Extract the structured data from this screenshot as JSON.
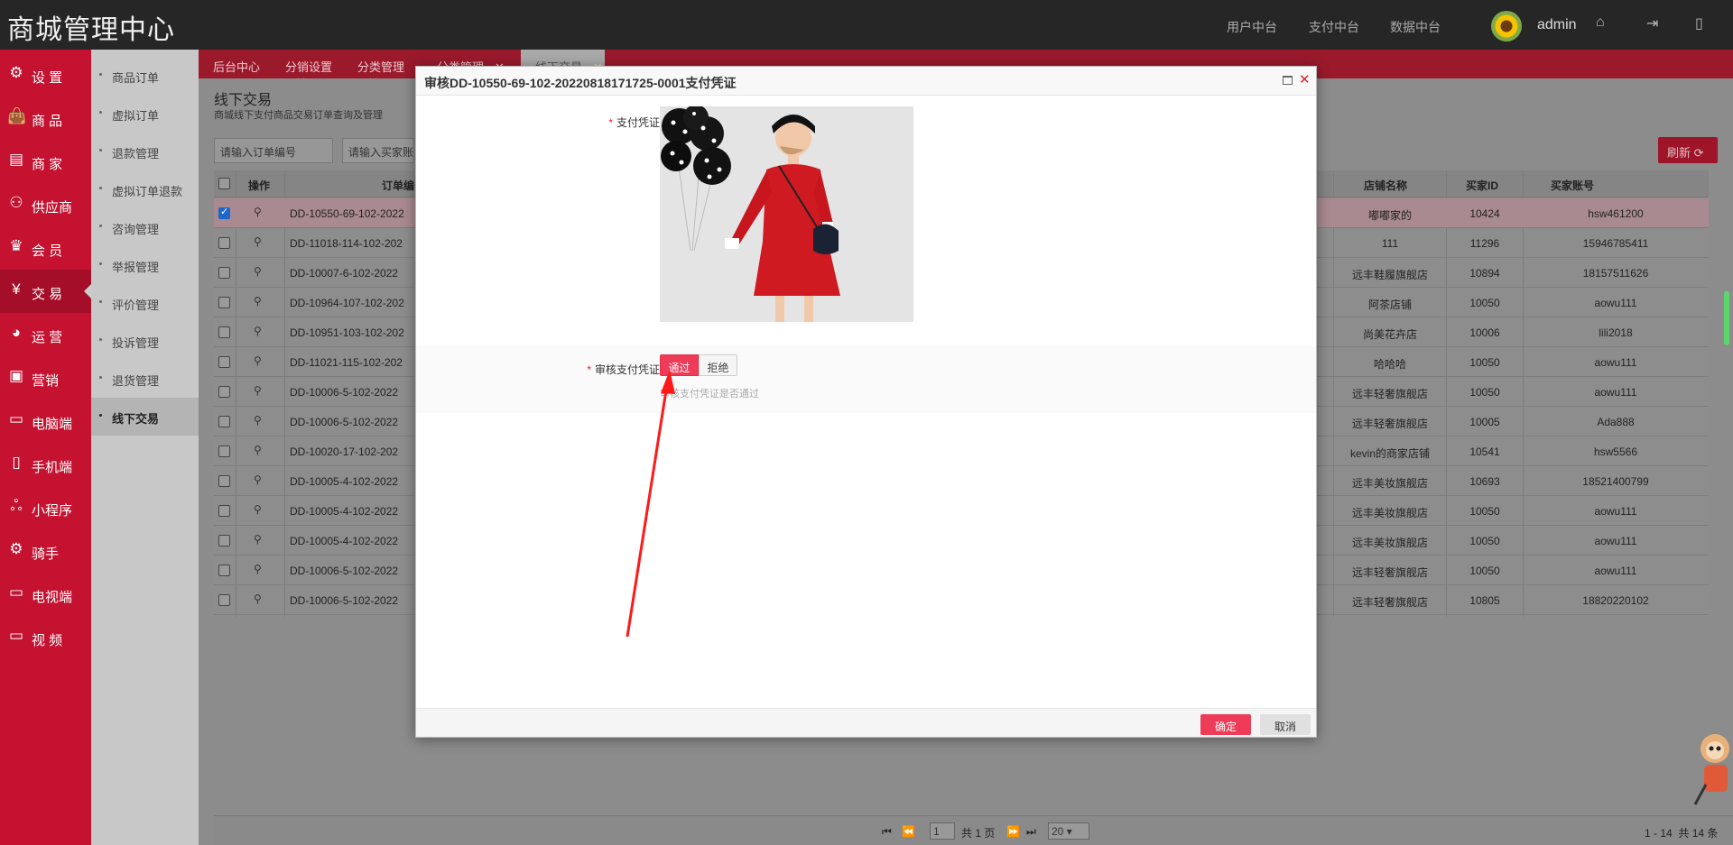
{
  "header": {
    "logo": "商城管理中心",
    "nav": [
      "用户中台",
      "支付中台",
      "数据中台"
    ],
    "username": "admin"
  },
  "menu": [
    {
      "label": "设 置",
      "icon": "gear-icon",
      "glyph": "⚙"
    },
    {
      "label": "商 品",
      "icon": "bag-icon",
      "glyph": "👜"
    },
    {
      "label": "商 家",
      "icon": "store-icon",
      "glyph": "▤"
    },
    {
      "label": "供应商",
      "icon": "supplier-icon",
      "glyph": "⚇"
    },
    {
      "label": "会 员",
      "icon": "crown-icon",
      "glyph": "♛"
    },
    {
      "label": "交 易",
      "icon": "yen-icon",
      "glyph": "¥"
    },
    {
      "label": "运 营",
      "icon": "pie-icon",
      "glyph": "◕"
    },
    {
      "label": "营销",
      "icon": "marketing-icon",
      "glyph": "▣"
    },
    {
      "label": "电脑端",
      "icon": "desktop-icon",
      "glyph": "▭"
    },
    {
      "label": "手机端",
      "icon": "mobile-icon",
      "glyph": "▯"
    },
    {
      "label": "小程序",
      "icon": "miniprogram-icon",
      "glyph": "ஃ"
    },
    {
      "label": "骑手",
      "icon": "rider-icon",
      "glyph": "⚙"
    },
    {
      "label": "电视端",
      "icon": "tv-icon",
      "glyph": "▭"
    },
    {
      "label": "视 频",
      "icon": "video-icon",
      "glyph": "▭"
    }
  ],
  "submenu": [
    "商品订单",
    "虚拟订单",
    "退款管理",
    "虚拟订单退款",
    "咨询管理",
    "举报管理",
    "评价管理",
    "投诉管理",
    "退货管理",
    "线下交易"
  ],
  "tabs": [
    {
      "label": "后台中心",
      "close": ""
    },
    {
      "label": "分销设置",
      "close": "✕"
    },
    {
      "label": "分类管理",
      "close": "✕"
    },
    {
      "label": "分类管理",
      "close": "✕"
    },
    {
      "label": "线下交易",
      "close": "✕"
    }
  ],
  "page": {
    "title": "线下交易",
    "subtitle": "商城线下支付商品交易订单查询及管理",
    "search_order_placeholder": "请输入订单编号",
    "search_buyer_placeholder": "请输入买家账号",
    "refresh": "刷新"
  },
  "table": {
    "headers": {
      "op": "操作",
      "order": "订单编号",
      "store": "店铺名称",
      "buyer_id": "买家ID",
      "buyer_account": "买家账号"
    },
    "rows": [
      {
        "order": "DD-10550-69-102-2022",
        "store": "嘟嘟家的",
        "buyer_id": "10424",
        "buyer_account": "hsw461200",
        "selected": true
      },
      {
        "order": "DD-11018-114-102-202",
        "store": "111",
        "buyer_id": "11296",
        "buyer_account": "15946785411",
        "selected": false
      },
      {
        "order": "DD-10007-6-102-2022",
        "store": "远丰鞋履旗舰店",
        "buyer_id": "10894",
        "buyer_account": "18157511626",
        "selected": false
      },
      {
        "order": "DD-10964-107-102-202",
        "store": "阿茶店铺",
        "buyer_id": "10050",
        "buyer_account": "aowu111",
        "selected": false
      },
      {
        "order": "DD-10951-103-102-202",
        "store": "尚美花卉店",
        "buyer_id": "10006",
        "buyer_account": "lili2018",
        "selected": false
      },
      {
        "order": "DD-11021-115-102-202",
        "store": "哈哈哈",
        "buyer_id": "10050",
        "buyer_account": "aowu111",
        "selected": false
      },
      {
        "order": "DD-10006-5-102-2022",
        "store": "远丰轻奢旗舰店",
        "buyer_id": "10050",
        "buyer_account": "aowu111",
        "selected": false
      },
      {
        "order": "DD-10006-5-102-2022",
        "store": "远丰轻奢旗舰店",
        "buyer_id": "10005",
        "buyer_account": "Ada888",
        "selected": false
      },
      {
        "order": "DD-10020-17-102-202",
        "store": "kevin的商家店铺",
        "buyer_id": "10541",
        "buyer_account": "hsw5566",
        "selected": false
      },
      {
        "order": "DD-10005-4-102-2022",
        "store": "远丰美妆旗舰店",
        "buyer_id": "10693",
        "buyer_account": "18521400799",
        "selected": false
      },
      {
        "order": "DD-10005-4-102-2022",
        "store": "远丰美妆旗舰店",
        "buyer_id": "10050",
        "buyer_account": "aowu111",
        "selected": false
      },
      {
        "order": "DD-10005-4-102-2022",
        "store": "远丰美妆旗舰店",
        "buyer_id": "10050",
        "buyer_account": "aowu111",
        "selected": false
      },
      {
        "order": "DD-10006-5-102-2022",
        "store": "远丰轻奢旗舰店",
        "buyer_id": "10050",
        "buyer_account": "aowu111",
        "selected": false
      },
      {
        "order": "DD-10006-5-102-2022",
        "store": "远丰轻奢旗舰店",
        "buyer_id": "10805",
        "buyer_account": "18820220102",
        "selected": false
      }
    ]
  },
  "pager": {
    "page_value": "1",
    "total_pages": "共 1 页",
    "page_size": "20",
    "range": "1 - 14",
    "total": "共 14 条"
  },
  "modal": {
    "title": "审核DD-10550-69-102-20220818171725-0001支付凭证",
    "label_voucher": "支付凭证",
    "label_review": "审核支付凭证",
    "pass": "通过",
    "reject": "拒绝",
    "hint": "审核支付凭证是否通过",
    "ok": "确定",
    "cancel": "取消"
  },
  "colors": {
    "brand_red": "#c41230",
    "accent_pink": "#ee3b58",
    "header_dark": "#262626"
  }
}
